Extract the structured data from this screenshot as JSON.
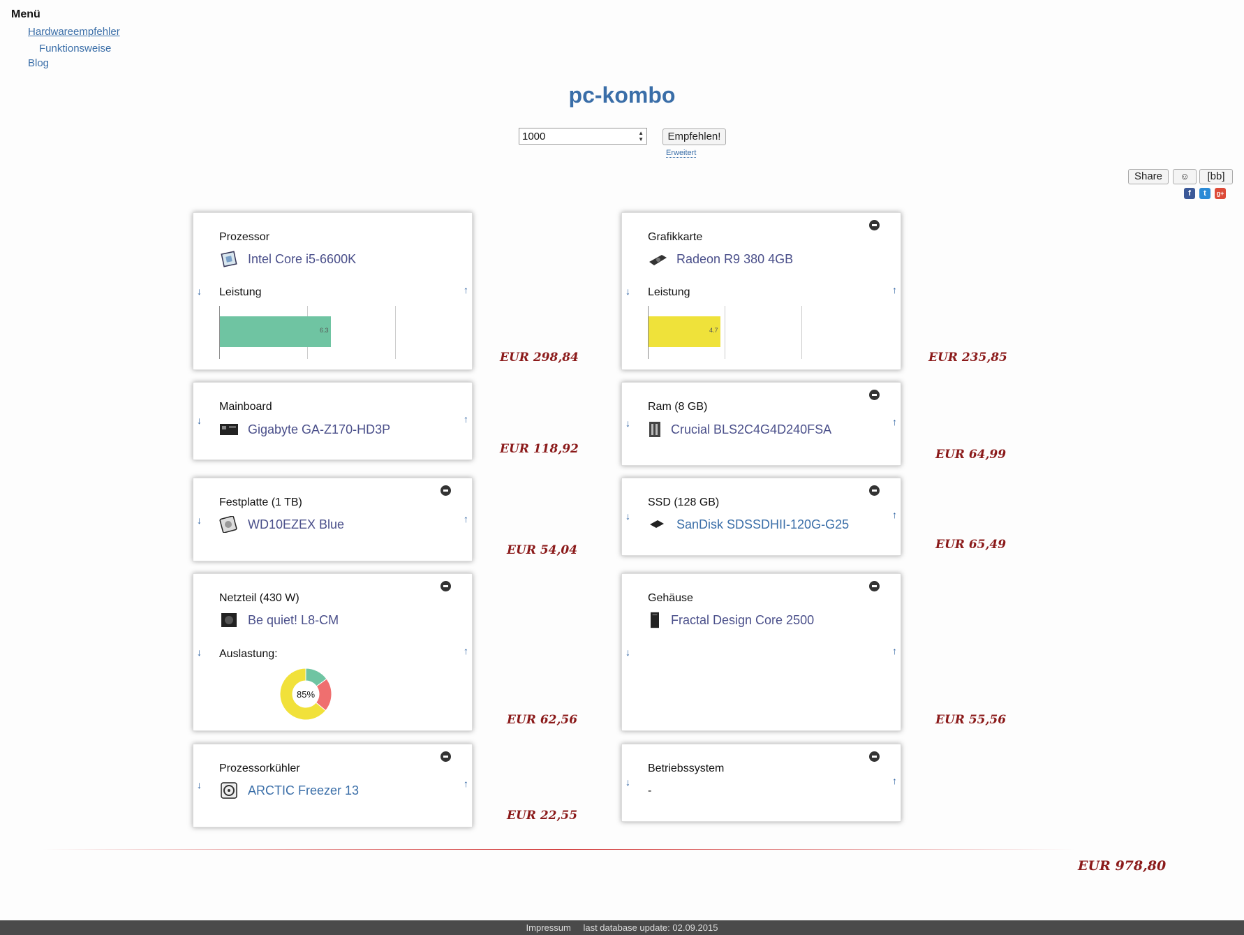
{
  "menu": {
    "title": "Menü",
    "items": [
      "Hardwareempfehler",
      "Funktionsweise",
      "Blog"
    ]
  },
  "page_title": "pc-kombo",
  "budget_input": {
    "value": "1000"
  },
  "recommend_button": "Empfehlen!",
  "advanced_link": "Erweitert",
  "share": {
    "label": "Share",
    "bb_label": "[bb]",
    "networks": [
      "facebook",
      "twitter",
      "google-plus"
    ]
  },
  "components": {
    "cpu": {
      "category": "Prozessor",
      "product": "Intel Core i5-6600K",
      "price": "EUR 298,84",
      "perf_label": "Leistung",
      "score": "6.3",
      "score_value": 6.3
    },
    "gpu": {
      "category": "Grafikkarte",
      "product": "Radeon R9 380 4GB",
      "price": "EUR 235,85",
      "perf_label": "Leistung",
      "score": "4.7",
      "score_value": 4.7
    },
    "mainboard": {
      "category": "Mainboard",
      "product": "Gigabyte GA-Z170-HD3P",
      "price": "EUR 118,92"
    },
    "ram": {
      "category": "Ram (8 GB)",
      "product": "Crucial BLS2C4G4D240FSA",
      "price": "EUR 64,99"
    },
    "hdd": {
      "category": "Festplatte (1 TB)",
      "product": "WD10EZEX Blue",
      "price": "EUR 54,04"
    },
    "ssd": {
      "category": "SSD (128 GB)",
      "product": "SanDisk SDSSDHII-120G-G25",
      "price": "EUR 65,49"
    },
    "psu": {
      "category": "Netzteil (430 W)",
      "product": "Be quiet! L8-CM",
      "price": "EUR 62,56",
      "load_label": "Auslastung:",
      "load_text": "85%",
      "load_value": 0.85
    },
    "case": {
      "category": "Gehäuse",
      "product": "Fractal Design Core 2500",
      "price": "EUR 55,56"
    },
    "cooler": {
      "category": "Prozessorkühler",
      "product": "ARCTIC Freezer 13",
      "price": "EUR 22,55"
    },
    "os": {
      "category": "Betriebssystem",
      "product": "-"
    }
  },
  "total": "EUR 978,80",
  "footer": {
    "impressum": "Impressum",
    "update": "last database update: 02.09.2015"
  },
  "colors": {
    "cpu_bar": "#6fc4a2",
    "gpu_bar": "#efe23a",
    "donut_green": "#6fc4a2",
    "donut_red": "#ef6f6f",
    "donut_yellow": "#f1e13a",
    "price": "#8b1a1a"
  }
}
